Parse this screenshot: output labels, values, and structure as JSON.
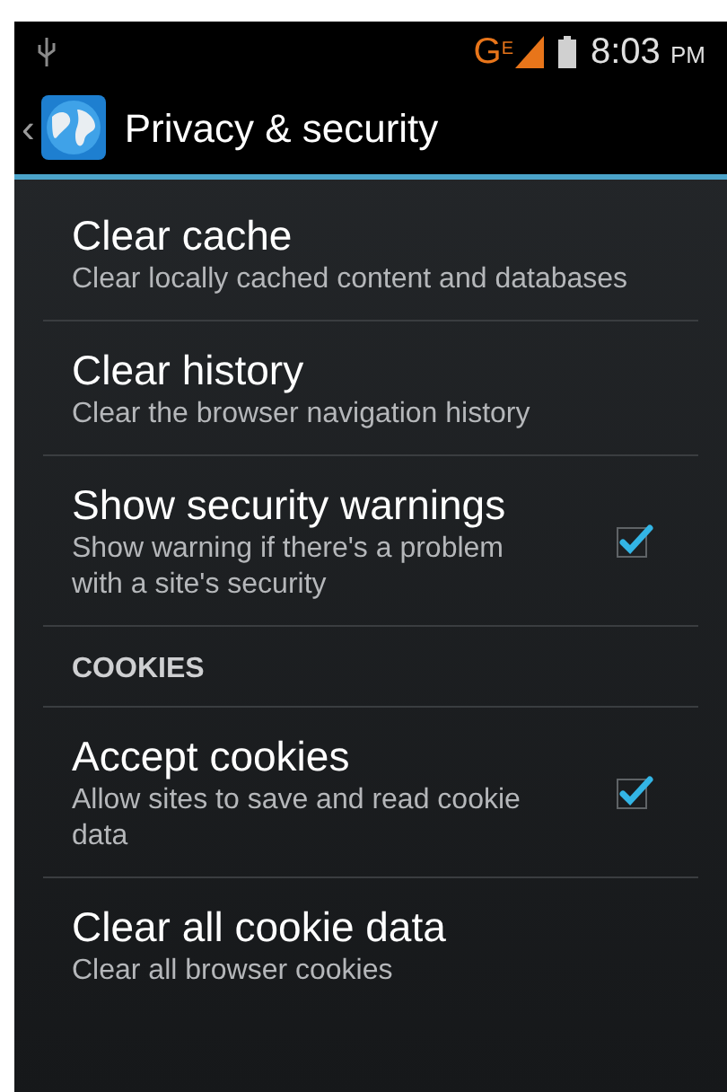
{
  "status_bar": {
    "network": "G",
    "network_sub": "E",
    "time": "8:03",
    "ampm": "PM"
  },
  "action_bar": {
    "back": "‹",
    "title": "Privacy & security"
  },
  "items": [
    {
      "kind": "item",
      "title": "Clear cache",
      "summary": "Clear locally cached content and databases"
    },
    {
      "kind": "item",
      "title": "Clear history",
      "summary": "Clear the browser navigation history"
    },
    {
      "kind": "check",
      "title": "Show security warnings",
      "summary": "Show warning if there's a problem with a site's security",
      "checked": true
    },
    {
      "kind": "header",
      "title": "COOKIES"
    },
    {
      "kind": "check",
      "title": "Accept cookies",
      "summary": "Allow sites to save and read cookie data",
      "checked": true
    },
    {
      "kind": "item",
      "title": "Clear all cookie data",
      "summary": "Clear all browser cookies"
    }
  ]
}
